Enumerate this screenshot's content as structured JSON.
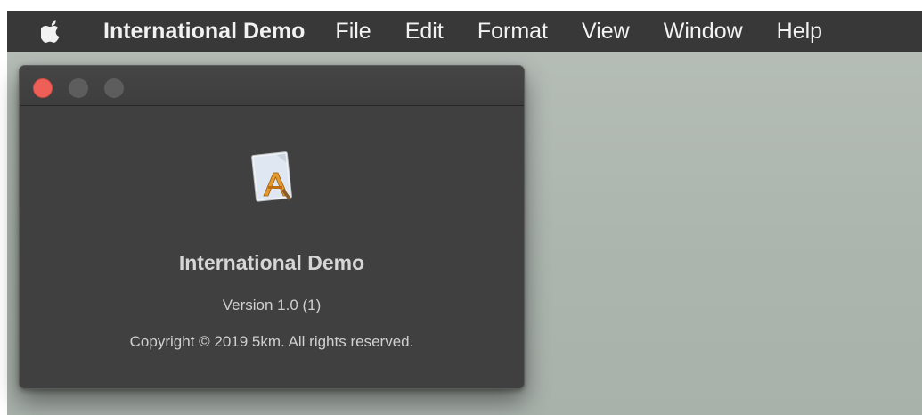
{
  "menubar": {
    "apple_icon": "apple-logo-icon",
    "app_name": "International Demo",
    "items": [
      "File",
      "Edit",
      "Format",
      "View",
      "Window",
      "Help"
    ]
  },
  "about_window": {
    "traffic_lights": {
      "close": "#ee5f57",
      "minimize": "#5d5d5d",
      "zoom": "#5d5d5d"
    },
    "app_icon": "xcode-app-document-icon",
    "app_name": "International Demo",
    "version": "Version 1.0 (1)",
    "copyright": "Copyright © 2019 5km. All rights reserved."
  },
  "colors": {
    "menubar_bg": "#383838",
    "window_bg": "#404040",
    "desktop_bg": "#adb5af"
  }
}
